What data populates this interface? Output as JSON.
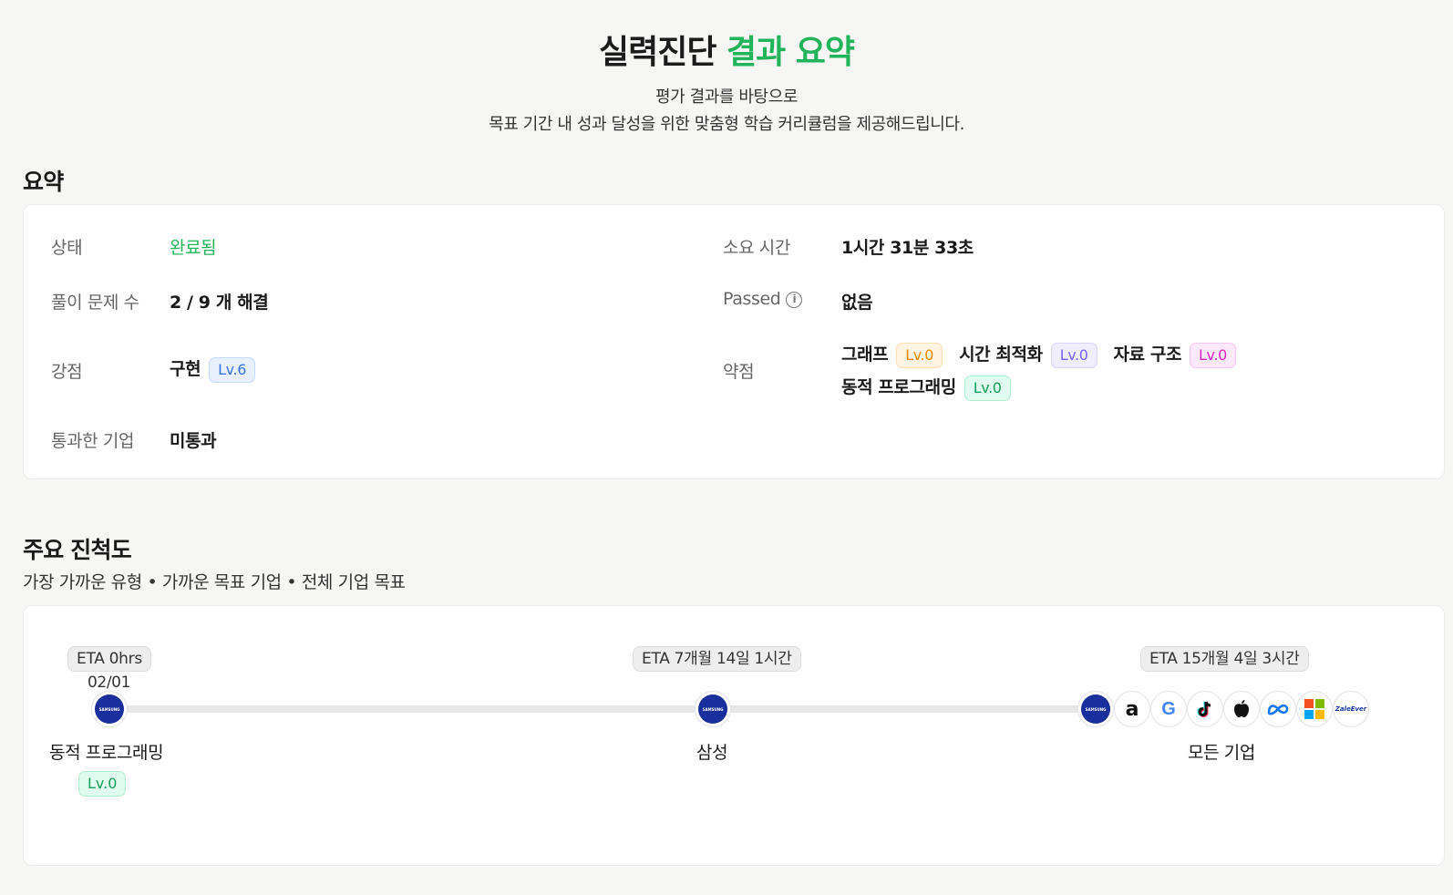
{
  "header": {
    "title_main": "실력진단",
    "title_accent": "결과 요약",
    "subtitle_line1": "평가 결과를 바탕으로",
    "subtitle_line2": "목표 기간 내 성과 달성을 위한 맞춤형 학습 커리큘럼을 제공해드립니다."
  },
  "summary": {
    "section_title": "요약",
    "status_label": "상태",
    "status_value": "완료됨",
    "time_label": "소요 시간",
    "time_value": "1시간 31분 33초",
    "solved_label": "풀이 문제 수",
    "solved_value": "2 / 9 개 해결",
    "passed_label": "Passed",
    "passed_value": "없음",
    "strength_label": "강점",
    "strength_value": "구현",
    "strength_level": "Lv.6",
    "weakness_label": "약점",
    "weaknesses": [
      {
        "name": "그래프",
        "level": "Lv.0"
      },
      {
        "name": "시간 최적화",
        "level": "Lv.0"
      },
      {
        "name": "자료 구조",
        "level": "Lv.0"
      },
      {
        "name": "동적 프로그래밍",
        "level": "Lv.0"
      }
    ],
    "company_label": "통과한 기업",
    "company_value": "미통과"
  },
  "progress": {
    "section_title": "주요 진척도",
    "subtitle": "가장 가까운 유형 • 가까운 목표 기업 • 전체 기업 목표",
    "milestones": [
      {
        "eta": "ETA 0hrs",
        "date": "02/01",
        "label": "동적 프로그래밍",
        "level": "Lv.0"
      },
      {
        "eta": "ETA 7개월 14일 1시간",
        "label": "삼성"
      },
      {
        "eta": "ETA 15개월 4일 3시간",
        "label": "모든 기업"
      }
    ],
    "company_icons": [
      "samsung-logo",
      "amazon-logo",
      "google-logo",
      "tiktok-logo",
      "apple-logo",
      "meta-logo",
      "microsoft-logo",
      "zaleever-logo"
    ],
    "samsung_text": "SAMSUNG",
    "zaleever_text": "ZaleEver"
  },
  "colors": {
    "accent_green": "#22b45a",
    "samsung_blue": "#1a2e9c"
  }
}
